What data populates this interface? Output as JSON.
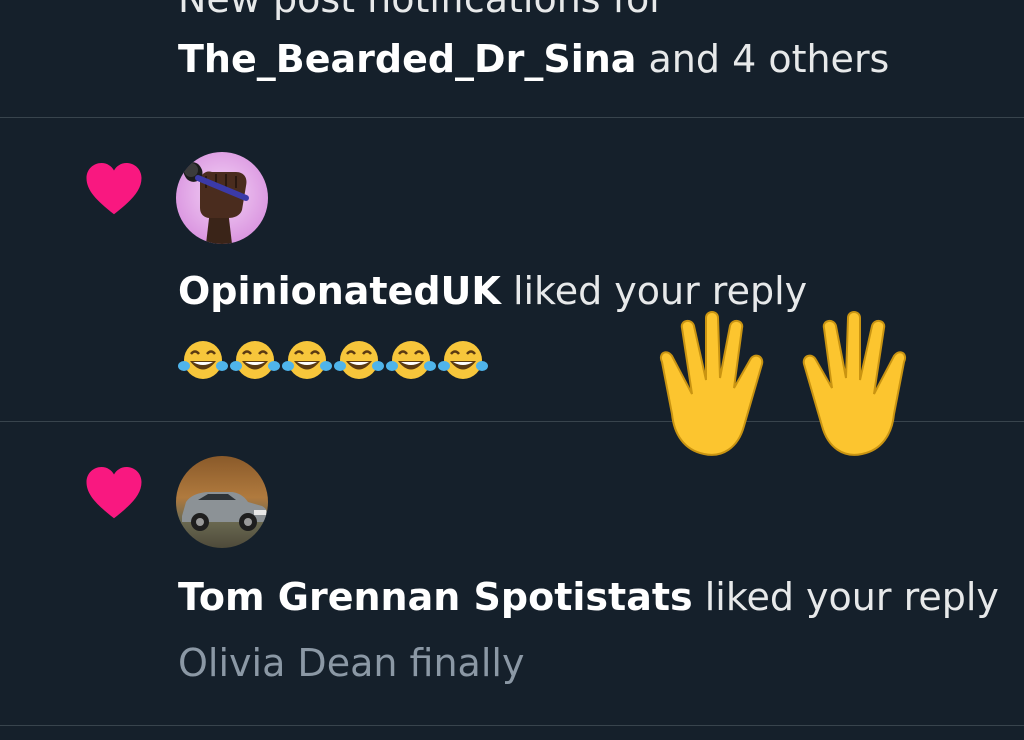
{
  "top_notification": {
    "line1": "New post notifications for",
    "user": "The_Bearded_Dr_Sina",
    "rest": " and 4 others"
  },
  "notifications": [
    {
      "user": "OpinionatedUK",
      "action": " liked your reply",
      "reply_text": "😂😂😂😂😂😂",
      "icon": "heart-icon",
      "avatar": "raised-fist-microphone-avatar"
    },
    {
      "user": "Tom Grennan Spotistats",
      "action": " liked your reply",
      "reply_text": "Olivia Dean finally",
      "icon": "heart-icon",
      "avatar": "vintage-car-avatar"
    }
  ],
  "overlay": {
    "icon": "raised-hands-icon"
  },
  "colors": {
    "background": "#15202b",
    "divider": "#38444d",
    "heart": "#f91880",
    "secondary_text": "#8b98a5"
  }
}
